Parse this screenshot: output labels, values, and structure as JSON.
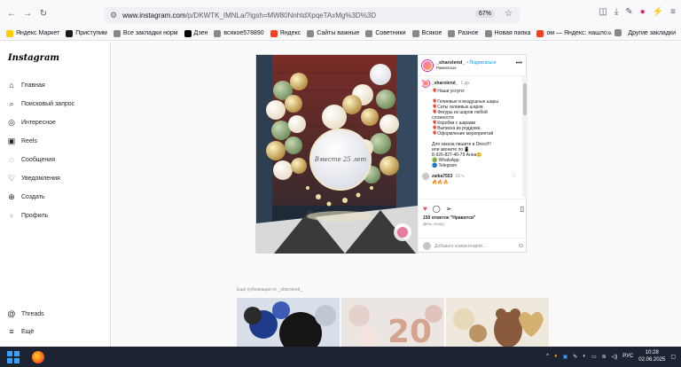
{
  "browser": {
    "url_host": "www.instagram.com",
    "url_path": "/p/DKWTK_IMNLa/?igsh=MW80NnhtdXpqeTAxMg%3D%3D",
    "zoom": "67%"
  },
  "bookmarks": [
    {
      "label": "Яндекс Маркет",
      "color": "#ffcc00"
    },
    {
      "label": "Приступим",
      "color": "#1a1a1a"
    },
    {
      "label": "Все закладки норм",
      "color": "#888888"
    },
    {
      "label": "Дзен",
      "color": "#000000"
    },
    {
      "label": "всякое578890",
      "color": "#888888"
    },
    {
      "label": "Яндекс",
      "color": "#fc3f1d"
    },
    {
      "label": "Сайты важные",
      "color": "#888888"
    },
    {
      "label": "Советники",
      "color": "#888888"
    },
    {
      "label": "Всякое",
      "color": "#888888"
    },
    {
      "label": "Разное",
      "color": "#888888"
    },
    {
      "label": "Новая папка",
      "color": "#888888"
    },
    {
      "label": "ом — Яндекс: нашло...",
      "color": "#fc3f1d"
    }
  ],
  "bookmarks_other": "Другие закладки",
  "sidebar": {
    "logo": "Instagram",
    "items": [
      {
        "label": "Главная",
        "icon": "home-icon"
      },
      {
        "label": "Поисковый запрос",
        "icon": "search-icon"
      },
      {
        "label": "Интересное",
        "icon": "compass-icon"
      },
      {
        "label": "Reels",
        "icon": "reels-icon"
      },
      {
        "label": "Сообщения",
        "icon": "messenger-icon"
      },
      {
        "label": "Уведомления",
        "icon": "heart-icon"
      },
      {
        "label": "Создать",
        "icon": "plus-icon"
      },
      {
        "label": "Профиль",
        "icon": "profile-icon"
      }
    ],
    "bottom": [
      {
        "label": "Threads",
        "icon": "threads-icon"
      },
      {
        "label": "Ещё",
        "icon": "menu-icon"
      }
    ]
  },
  "post": {
    "username": "_sharolend_",
    "follow": "• Подписаться",
    "location": "Раменское",
    "caption_user": "_sharolend_",
    "caption_time": "1 дн.",
    "caption_lines": [
      "🎈Наши услуги:",
      "",
      "🎈Гелиевые и воздушные шары",
      "🎈Сеты гелиевых шаров",
      "🎈Фигуры из шаров любой",
      "сложности",
      "🎈Коробки с шарами",
      "🎈Выписка из роддома",
      "🎈Оформление мероприятий",
      "",
      "Для заказа пишите в Direct!!!",
      "или звоните по 📱",
      "8-926-827-40-79 Анна😊",
      "🟢 WhatsApp",
      "🔵 Telegram"
    ],
    "comment_user": "zaika7553",
    "comment_time": "10 ч.",
    "comment_text": "🔥🔥🔥",
    "likes": "150 отметок \"Нравится\"",
    "date": "День назад",
    "comment_placeholder": "Добавьте комментарий...",
    "photo_text": "Вместе 25 лет"
  },
  "more_posts_label": "Ещё публикации от _sharolend_",
  "taskbar": {
    "lang": "РУС",
    "time": "10:28",
    "date": "02.06.2025"
  }
}
